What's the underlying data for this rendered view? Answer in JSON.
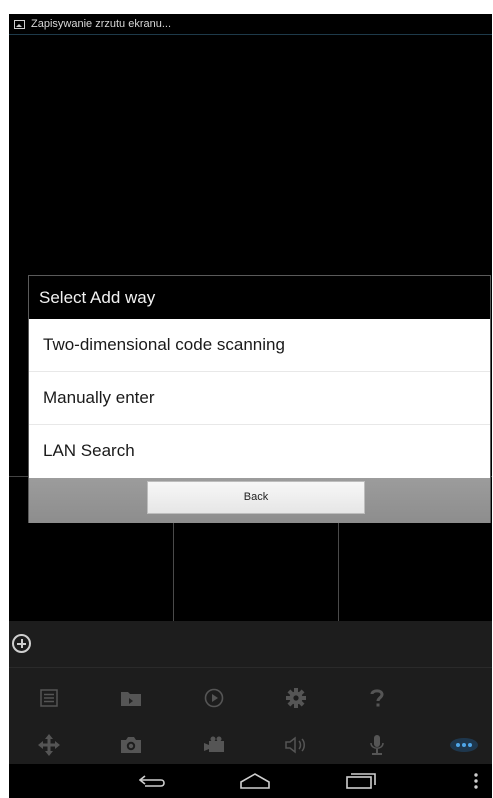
{
  "status_bar": {
    "icon": "screenshot-icon",
    "notification_text": "Zapisywanie zrzutu ekranu..."
  },
  "dialog": {
    "title": "Select Add way",
    "options": [
      "Two-dimensional code scanning",
      "Manually enter",
      "LAN Search"
    ],
    "back_label": "Back"
  },
  "toolbar": {
    "add_icon": "add-circle-icon",
    "row1_icons": [
      "list-icon",
      "folder-icon",
      "playback-icon",
      "settings-icon",
      "help-icon"
    ],
    "row2_icons": [
      "ptz-move-icon",
      "camera-icon",
      "record-icon",
      "speaker-icon",
      "microphone-icon",
      "more-icon"
    ],
    "colors": {
      "icon_dim": "#555555",
      "icon_active": "#2d7fc4"
    }
  },
  "nav_bar": {
    "icons": [
      "back-icon",
      "home-icon",
      "recent-apps-icon",
      "overflow-menu-icon"
    ]
  }
}
